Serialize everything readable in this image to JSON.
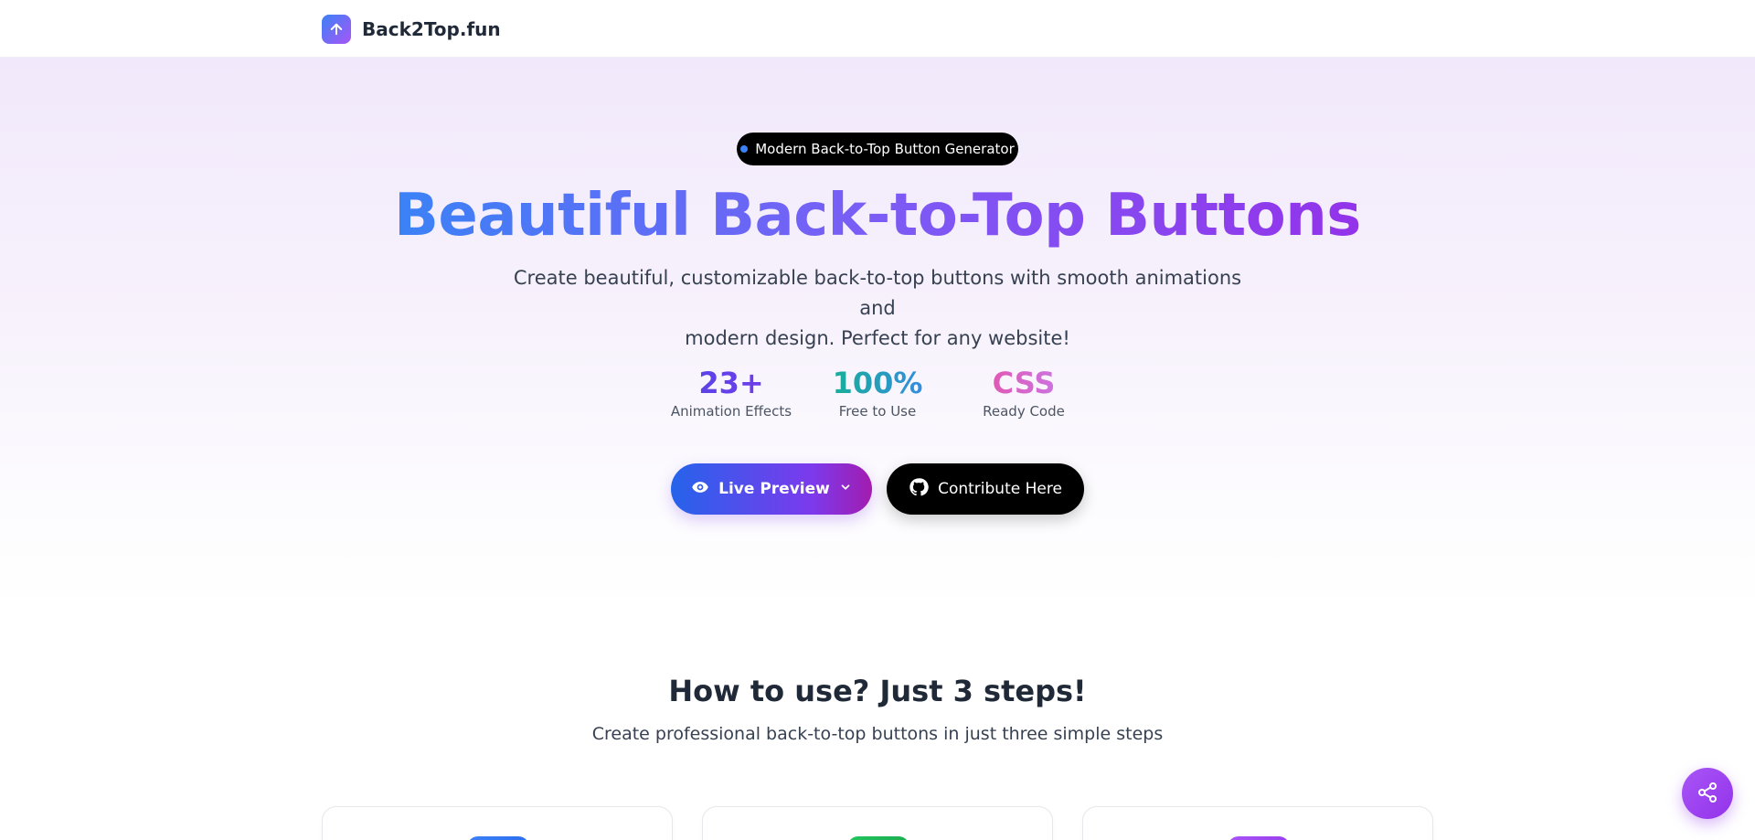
{
  "header": {
    "brand_name": "Back2Top.fun",
    "logo_icon": "arrow-up-icon"
  },
  "hero": {
    "badge": "Modern Back-to-Top Button Generator",
    "title": "Beautiful Back-to-Top Buttons",
    "subtitle_line1": "Create beautiful, customizable back-to-top buttons with smooth animations and",
    "subtitle_line2": "modern design. Perfect for any website!",
    "stats": [
      {
        "value": "23+",
        "label": "Animation Effects"
      },
      {
        "value": "100%",
        "label": "Free to Use"
      },
      {
        "value": "CSS",
        "label": "Ready Code"
      }
    ],
    "preview_button": "Live Preview",
    "contribute_button": "Contribute Here"
  },
  "steps": {
    "title": "How to use? Just 3 steps!",
    "subtitle": "Create professional back-to-top buttons in just three simple steps"
  },
  "colors": {
    "accent_blue": "#3b82f6",
    "accent_purple": "#9333ea",
    "badge_bg": "#000000"
  },
  "share_icon": "share-icon"
}
